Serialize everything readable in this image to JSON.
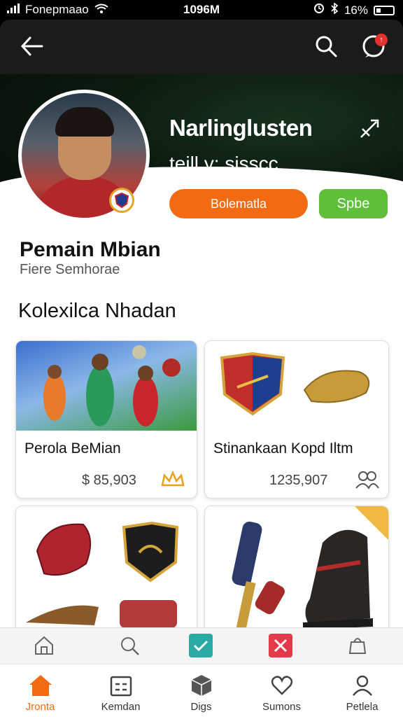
{
  "status_bar": {
    "carrier": "Fonepmaao",
    "time": "1096M",
    "battery": "16%"
  },
  "profile": {
    "name": "Narlinglusten",
    "subtitle": "teill y: sisscc",
    "primary_button": "Bolematla",
    "secondary_button": "Spbe"
  },
  "section": {
    "title": "Pemain Mbian",
    "subtitle": "Fiere Semhorae",
    "collection_title": "Kolexilca Nhadan"
  },
  "cards": [
    {
      "title": "Perola BeMian",
      "price": "$ 85,903",
      "icon": "crown-icon"
    },
    {
      "title": "Stinankaan Kopd Iltm",
      "price": "1235,907",
      "icon": "group-icon"
    },
    {
      "title": "",
      "price": "",
      "icon": "shield-icon"
    },
    {
      "title": "",
      "price": "",
      "icon": "boot-icon"
    }
  ],
  "toolbar": {
    "items": [
      "home-outline-icon",
      "search-icon",
      "check-icon",
      "tools-icon",
      "bag-icon"
    ],
    "check_color": "#2aa9a5",
    "tools_color": "#e23a4a"
  },
  "bottom_nav": {
    "items": [
      {
        "label": "Jronta",
        "icon": "home-icon"
      },
      {
        "label": "Kemdan",
        "icon": "calendar-icon"
      },
      {
        "label": "Digs",
        "icon": "box-icon"
      },
      {
        "label": "Sumons",
        "icon": "heart-icon"
      },
      {
        "label": "Petlela",
        "icon": "person-icon"
      }
    ],
    "active_color": "#f26a12"
  },
  "colors": {
    "orange": "#f26a12",
    "green": "#5fbf3b",
    "dark": "#1b1b1b"
  }
}
